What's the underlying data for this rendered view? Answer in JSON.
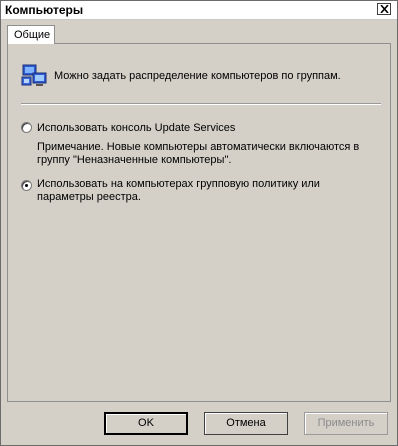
{
  "window": {
    "title": "Компьютеры"
  },
  "tabs": [
    {
      "label": "Общие"
    }
  ],
  "panel": {
    "info_text": "Можно задать распределение компьютеров по группам.",
    "options": [
      {
        "label": "Использовать консоль Update Services",
        "selected": false
      },
      {
        "label": "Использовать на компьютерах групповую политику или параметры реестра.",
        "selected": true
      }
    ],
    "note": "Примечание. Новые компьютеры автоматически включаются в группу \"Неназначенные компьютеры\"."
  },
  "buttons": {
    "ok": "OK",
    "cancel": "Отмена",
    "apply": "Применить"
  },
  "icons": {
    "close": "close-icon",
    "info": "computers-group-icon"
  },
  "colors": {
    "dialog_bg": "#d4d0c8",
    "disabled_text": "#8a8a8a"
  }
}
